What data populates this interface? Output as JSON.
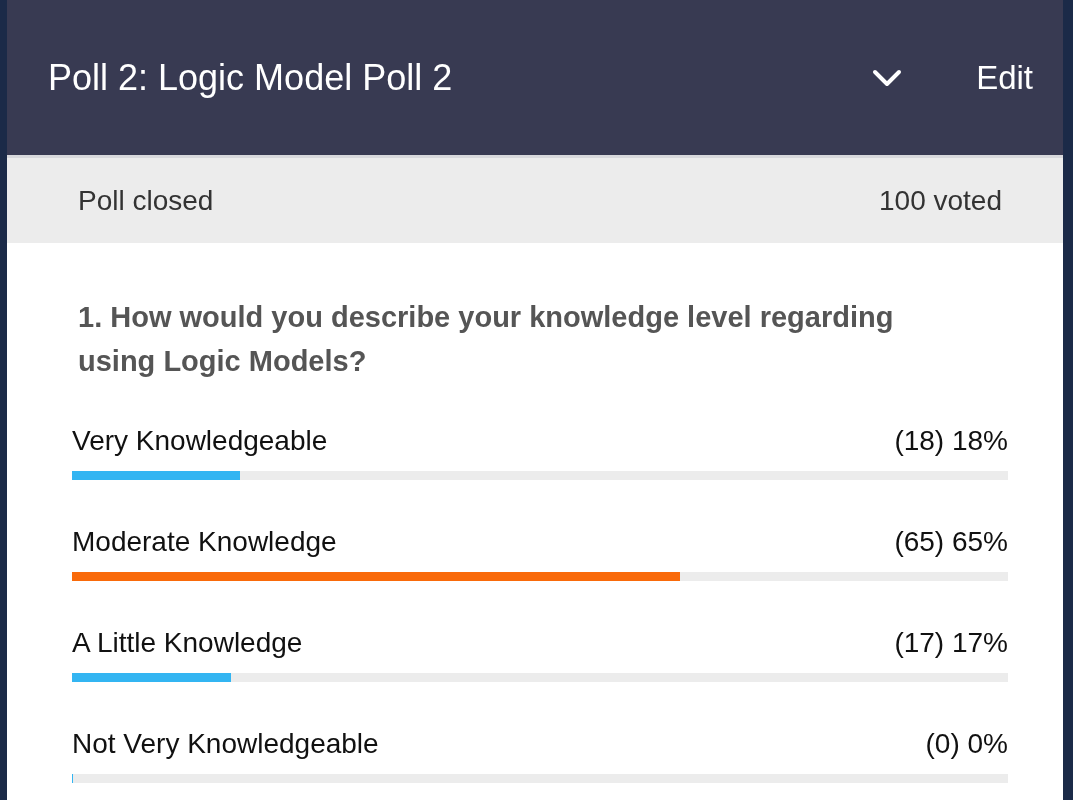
{
  "header": {
    "title": "Poll 2: Logic Model Poll 2",
    "edit": "Edit"
  },
  "status": {
    "state": "Poll closed",
    "voted": "100 voted"
  },
  "question": "1. How would you describe your knowledge level regarding using Logic Models?",
  "options": [
    {
      "label": "Very Knowledgeable",
      "result": "(18) 18%",
      "level": 0.18,
      "leading": false
    },
    {
      "label": "Moderate Knowledge",
      "result": "(65) 65%",
      "level": 0.65,
      "leading": true
    },
    {
      "label": "A Little Knowledge",
      "result": "(17) 17%",
      "level": 0.17,
      "leading": false
    },
    {
      "label": "Not Very Knowledgeable",
      "result": "(0) 0%",
      "level": 0
    }
  ]
}
